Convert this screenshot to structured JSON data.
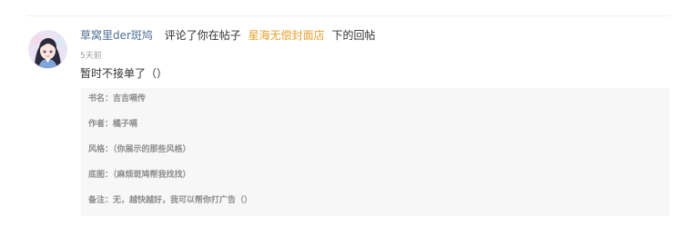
{
  "notification": {
    "username": "草窝里der斑鸠",
    "action": "评论了你在帖子",
    "post_title": "星海无偿封面店",
    "suffix": "下的回帖",
    "time": "5天前",
    "comment": "暂时不接单了（）"
  },
  "quote": {
    "lines": [
      "书名：吉吉嗝传",
      "作者：橘子嗝",
      "风格：（你展示的那些风格）",
      "底图：（麻烦斑鸠帮我找找）",
      "备注：无，越快越好，我可以帮你打广告（）"
    ]
  },
  "colors": {
    "username": "#4f6f96",
    "post_link": "#e6a12e",
    "body_text": "#333333",
    "meta_text": "#9a9a9a",
    "quote_background": "#f7f7f7",
    "quote_text": "#8c8c8c"
  },
  "icons": {
    "avatar": "user-avatar-anime-illustration"
  }
}
